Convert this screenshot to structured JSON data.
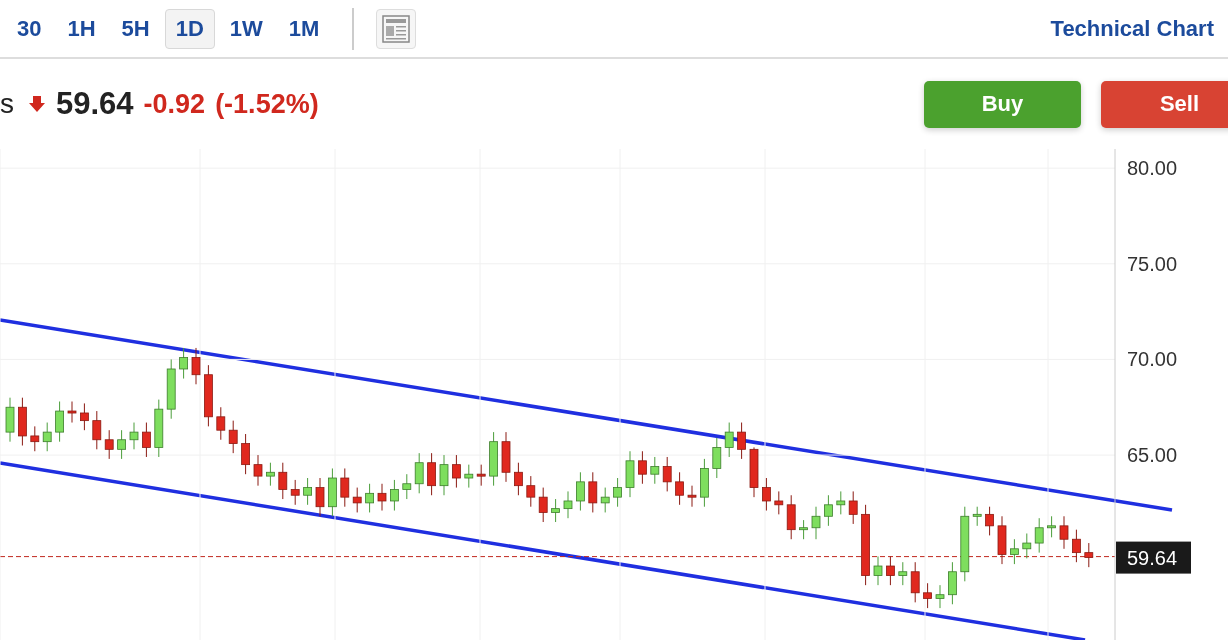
{
  "toolbar": {
    "timeframes": [
      {
        "label": "30",
        "selected": false
      },
      {
        "label": "1H",
        "selected": false
      },
      {
        "label": "5H",
        "selected": false
      },
      {
        "label": "1D",
        "selected": true
      },
      {
        "label": "1W",
        "selected": false
      },
      {
        "label": "1M",
        "selected": false
      }
    ],
    "link": "Technical Chart"
  },
  "quote": {
    "symbol": "s",
    "falling": true,
    "price": "59.64",
    "change": "-0.92",
    "percent": "(-1.52%)"
  },
  "buttons": [
    {
      "label": "Buy",
      "kind": "buy"
    },
    {
      "label": "Sell",
      "kind": "sell"
    }
  ],
  "chart": {
    "last_price_label": "59.64",
    "chart_data": {
      "type": "candlestick",
      "ylim": [
        55.28,
        81
      ],
      "grid": true,
      "yticks": [
        {
          "value": 80,
          "label": "80.00"
        },
        {
          "value": 75,
          "label": "75.00"
        },
        {
          "value": 70,
          "label": "70.00"
        },
        {
          "value": 65,
          "label": "65.00"
        }
      ],
      "ohlc": [
        [
          66.2,
          68.0,
          65.7,
          67.5
        ],
        [
          67.5,
          68.0,
          65.5,
          66.0
        ],
        [
          66.0,
          66.5,
          65.2,
          65.7
        ],
        [
          65.7,
          66.7,
          65.2,
          66.2
        ],
        [
          66.2,
          67.8,
          65.7,
          67.3
        ],
        [
          67.3,
          67.8,
          66.7,
          67.2
        ],
        [
          67.2,
          67.7,
          66.3,
          66.8
        ],
        [
          66.8,
          67.3,
          65.3,
          65.8
        ],
        [
          65.8,
          66.3,
          64.8,
          65.3
        ],
        [
          65.3,
          66.3,
          64.8,
          65.8
        ],
        [
          65.8,
          66.7,
          65.3,
          66.2
        ],
        [
          66.2,
          66.7,
          64.9,
          65.4
        ],
        [
          65.4,
          67.9,
          64.9,
          67.4
        ],
        [
          67.4,
          70.0,
          66.9,
          69.5
        ],
        [
          69.5,
          70.6,
          69.0,
          70.1
        ],
        [
          70.1,
          70.6,
          68.7,
          69.2
        ],
        [
          69.2,
          69.7,
          66.5,
          67.0
        ],
        [
          67.0,
          67.5,
          65.8,
          66.3
        ],
        [
          66.3,
          66.8,
          65.1,
          65.6
        ],
        [
          65.6,
          66.1,
          64.0,
          64.5
        ],
        [
          64.5,
          65.0,
          63.4,
          63.9
        ],
        [
          63.9,
          64.6,
          63.4,
          64.1
        ],
        [
          64.1,
          64.6,
          62.7,
          63.2
        ],
        [
          63.2,
          63.7,
          62.4,
          62.9
        ],
        [
          62.9,
          63.8,
          62.4,
          63.3
        ],
        [
          63.3,
          63.8,
          61.8,
          62.3
        ],
        [
          62.3,
          64.3,
          61.8,
          63.8
        ],
        [
          63.8,
          64.3,
          62.3,
          62.8
        ],
        [
          62.8,
          63.3,
          62.0,
          62.5
        ],
        [
          62.5,
          63.5,
          62.0,
          63.0
        ],
        [
          63.0,
          63.5,
          62.1,
          62.6
        ],
        [
          62.6,
          63.7,
          62.1,
          63.2
        ],
        [
          63.2,
          64.0,
          62.7,
          63.5
        ],
        [
          63.5,
          65.1,
          63.0,
          64.6
        ],
        [
          64.6,
          65.1,
          62.9,
          63.4
        ],
        [
          63.4,
          65.0,
          62.9,
          64.5
        ],
        [
          64.5,
          65.0,
          63.3,
          63.8
        ],
        [
          63.8,
          64.5,
          63.3,
          64.0
        ],
        [
          64.0,
          64.5,
          63.4,
          63.9
        ],
        [
          63.9,
          66.2,
          63.4,
          65.7
        ],
        [
          65.7,
          66.2,
          63.6,
          64.1
        ],
        [
          64.1,
          64.6,
          62.9,
          63.4
        ],
        [
          63.4,
          63.9,
          62.3,
          62.8
        ],
        [
          62.8,
          63.3,
          61.5,
          62.0
        ],
        [
          62.0,
          62.7,
          61.5,
          62.2
        ],
        [
          62.2,
          63.1,
          61.7,
          62.6
        ],
        [
          62.6,
          64.1,
          62.1,
          63.6
        ],
        [
          63.6,
          64.1,
          62.0,
          62.5
        ],
        [
          62.5,
          63.3,
          62.0,
          62.8
        ],
        [
          62.8,
          63.8,
          62.3,
          63.3
        ],
        [
          63.3,
          65.2,
          62.8,
          64.7
        ],
        [
          64.7,
          65.2,
          63.5,
          64.0
        ],
        [
          64.0,
          64.9,
          63.5,
          64.4
        ],
        [
          64.4,
          64.9,
          63.1,
          63.6
        ],
        [
          63.6,
          64.1,
          62.4,
          62.9
        ],
        [
          62.9,
          63.4,
          62.3,
          62.8
        ],
        [
          62.8,
          64.8,
          62.3,
          64.3
        ],
        [
          64.3,
          65.9,
          63.8,
          65.4
        ],
        [
          65.4,
          66.7,
          64.9,
          66.2
        ],
        [
          66.2,
          66.7,
          64.8,
          65.3
        ],
        [
          65.3,
          65.4,
          62.8,
          63.3
        ],
        [
          63.3,
          63.8,
          62.1,
          62.6
        ],
        [
          62.6,
          63.1,
          61.9,
          62.4
        ],
        [
          62.4,
          62.9,
          60.6,
          61.1
        ],
        [
          61.1,
          61.6,
          60.6,
          61.2
        ],
        [
          61.2,
          62.3,
          60.6,
          61.8
        ],
        [
          61.8,
          62.9,
          61.3,
          62.4
        ],
        [
          62.4,
          63.1,
          61.9,
          62.6
        ],
        [
          62.6,
          63.1,
          61.4,
          61.9
        ],
        [
          61.9,
          62.4,
          58.2,
          58.7
        ],
        [
          58.7,
          59.7,
          58.2,
          59.2
        ],
        [
          59.2,
          59.7,
          58.2,
          58.7
        ],
        [
          58.7,
          59.4,
          58.2,
          58.9
        ],
        [
          58.9,
          59.4,
          57.3,
          57.8
        ],
        [
          57.8,
          58.3,
          57.0,
          57.5
        ],
        [
          57.5,
          58.2,
          57.0,
          57.7
        ],
        [
          57.7,
          59.4,
          57.2,
          58.9
        ],
        [
          58.9,
          62.3,
          58.4,
          61.8
        ],
        [
          61.8,
          62.3,
          61.3,
          61.9
        ],
        [
          61.9,
          62.3,
          60.8,
          61.3
        ],
        [
          61.3,
          61.8,
          59.3,
          59.8
        ],
        [
          59.8,
          60.6,
          59.3,
          60.1
        ],
        [
          60.1,
          60.9,
          59.6,
          60.4
        ],
        [
          60.4,
          61.7,
          59.9,
          61.2
        ],
        [
          61.2,
          61.8,
          60.7,
          61.3
        ],
        [
          61.3,
          61.8,
          60.1,
          60.6
        ],
        [
          60.6,
          61.1,
          59.4,
          59.9
        ],
        [
          59.9,
          60.4,
          59.14,
          59.64
        ]
      ]
    }
  }
}
